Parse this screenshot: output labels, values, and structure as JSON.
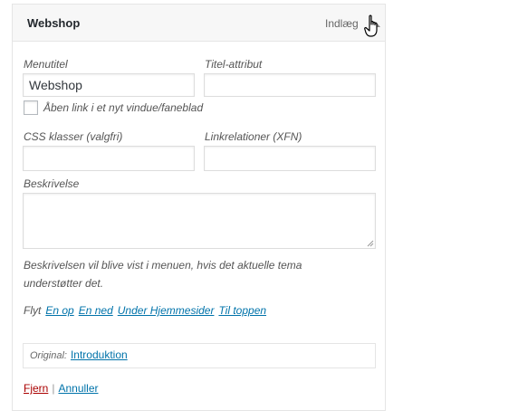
{
  "header": {
    "title": "Webshop",
    "item_type": "Indlæg"
  },
  "fields": {
    "menu_title": {
      "label": "Menutitel",
      "value": "Webshop"
    },
    "title_attr": {
      "label": "Titel-attribut",
      "value": ""
    },
    "new_tab": {
      "label": "Åben link i et nyt vindue/faneblad",
      "checked": false
    },
    "css_classes": {
      "label": "CSS klasser (valgfri)",
      "value": ""
    },
    "link_rel": {
      "label": "Linkrelationer (XFN)",
      "value": ""
    },
    "description": {
      "label": "Beskrivelse",
      "value": "",
      "note": "Beskrivelsen vil blive vist i menuen, hvis det aktuelle tema understøtter det."
    }
  },
  "move": {
    "label": "Flyt",
    "links": [
      "En op",
      "En ned",
      "Under Hjemmesider",
      "Til toppen"
    ]
  },
  "original": {
    "label": "Original:",
    "link": "Introduktion"
  },
  "actions": {
    "remove": "Fjern",
    "separator": "|",
    "cancel": "Annuller"
  },
  "colors": {
    "link": "#0073aa",
    "remove": "#aa0000",
    "border": "#e5e5e5"
  }
}
